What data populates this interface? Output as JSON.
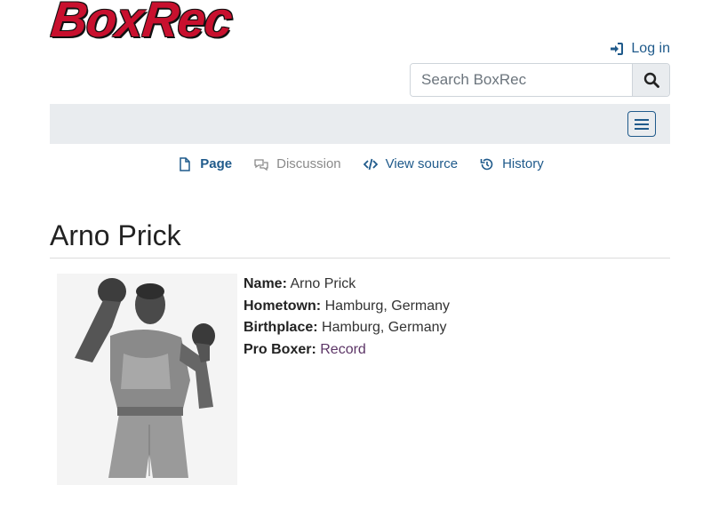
{
  "header": {
    "logo_text": "BoxRec",
    "login_label": "Log in",
    "search_placeholder": "Search BoxRec"
  },
  "tabs": [
    {
      "label": "Page",
      "icon": "file-icon",
      "active": true
    },
    {
      "label": "Discussion",
      "icon": "comments-icon",
      "active": false
    },
    {
      "label": "View source",
      "icon": "code-icon",
      "active": false
    },
    {
      "label": "History",
      "icon": "history-icon",
      "active": false
    }
  ],
  "page": {
    "title": "Arno Prick"
  },
  "info": {
    "name_label": "Name:",
    "name_value": "Arno Prick",
    "hometown_label": "Hometown:",
    "hometown_value": "Hamburg, Germany",
    "birthplace_label": "Birthplace:",
    "birthplace_value": "Hamburg, Germany",
    "pro_label": "Pro Boxer:",
    "pro_link": "Record"
  },
  "colors": {
    "logo": "#c8102e",
    "link": "#1f5a8b",
    "visited_link": "#5c3566",
    "navbar": "#e9ecef"
  }
}
